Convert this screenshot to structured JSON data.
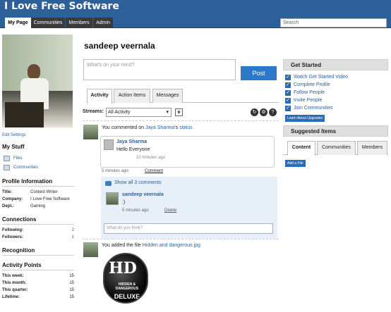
{
  "app": {
    "title": "I Love Free Software"
  },
  "nav": {
    "tabs": [
      "My Page",
      "Communities",
      "Members",
      "Admin"
    ],
    "search_placeholder": "Search"
  },
  "left": {
    "edit_settings": "Edit Settings",
    "my_stuff": {
      "title": "My Stuff",
      "items": [
        "Files",
        "Communities"
      ]
    },
    "profile": {
      "title": "Profile Information",
      "rows": [
        {
          "k": "Title:",
          "v": "Content Writer"
        },
        {
          "k": "Company:",
          "v": "I Love Free Software"
        },
        {
          "k": "Dept.:",
          "v": "Gaming"
        }
      ]
    },
    "connections": {
      "title": "Connections",
      "rows": [
        {
          "k": "Following:",
          "n": "2"
        },
        {
          "k": "Followers:",
          "n": "1"
        }
      ]
    },
    "recognition": "Recognition",
    "activity": {
      "title": "Activity Points",
      "rows": [
        {
          "k": "This week:",
          "n": "15"
        },
        {
          "k": "This month:",
          "n": "15"
        },
        {
          "k": "This quarter:",
          "n": "15"
        },
        {
          "k": "Lifetime:",
          "n": "15"
        }
      ]
    }
  },
  "main": {
    "username": "sandeep veernala",
    "mind_placeholder": "What's on your mind?",
    "post_label": "Post",
    "tabs": [
      "Activity",
      "Action Items",
      "Messages"
    ],
    "streams_label": "Streams:",
    "streams_value": "All Activity",
    "feed1": {
      "pre": "You commented on",
      "user": "Jaya Sharma",
      "possessive": "'s",
      "target": "status",
      "card_user": "Jaya Sharma",
      "card_text": "Hello Everyone",
      "card_time": "10 minutes ago",
      "time": "5 minutes ago",
      "comment_link": "Comment",
      "show_all": "Show all 3 comments",
      "reply_user": "sandeep veernala",
      "reply_text": ":)",
      "reply_time": "5 minutes ago",
      "delete_link": "Delete",
      "think_placeholder": "What do you think?"
    },
    "feed2": {
      "pre": "You added the file",
      "file": "Hidden and dangerous.jpg"
    },
    "image": {
      "logo": "HD",
      "line1": "HIDDEN &",
      "line2": "DANGEROUS",
      "line3": "DELUXE"
    }
  },
  "right": {
    "get_started": {
      "title": "Get Started",
      "items": [
        "Watch Get Started Video",
        "Complete Profile",
        "Follow People",
        "Invite People",
        "Join Communities"
      ],
      "button": "Learn About Upgrades"
    },
    "suggested": {
      "title": "Suggested Items",
      "tabs": [
        "Content",
        "Communities",
        "Members"
      ],
      "button": "Add a File"
    }
  }
}
